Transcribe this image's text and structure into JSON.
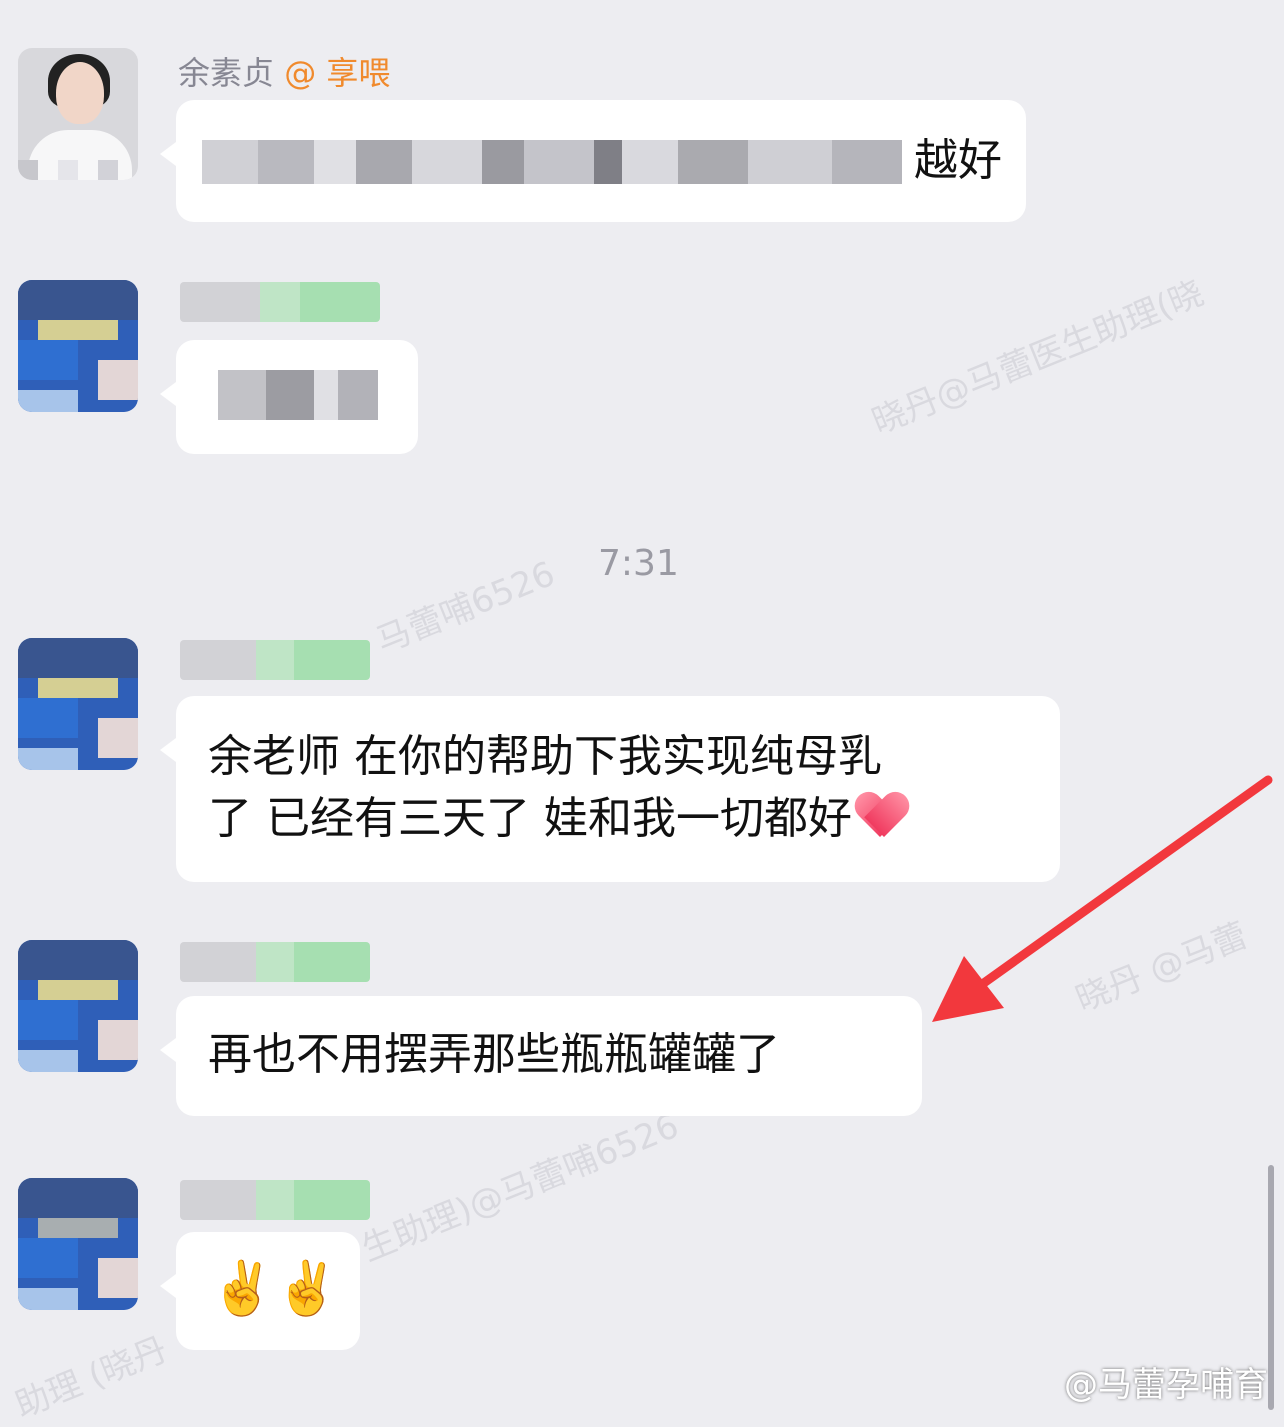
{
  "messages": [
    {
      "sender": "余素贞",
      "mention": "@ 享喂",
      "visible_text": "越好"
    },
    {
      "visible_text": ""
    },
    {
      "text": "余老师  在你的帮助下我实现纯母乳\n了 已经有三天了 娃和我一切都好",
      "emoji": "heart"
    },
    {
      "text": "再也不用摆弄那些瓶瓶罐罐了"
    },
    {
      "emoji_text": "✌️✌️"
    }
  ],
  "timestamp": "7:31",
  "watermarks": [
    "晓丹@马蕾医生助理(晓",
    "马蕾哺6526",
    "晓丹 @马蕾医生助理(晓",
    "生助理)@马蕾哺6526",
    "晓丹 @马蕾",
    "助理 (晓丹"
  ],
  "footer": "@马蕾孕哺育",
  "annotation": {
    "type": "arrow",
    "color": "#f2383d",
    "target": "message-4"
  }
}
